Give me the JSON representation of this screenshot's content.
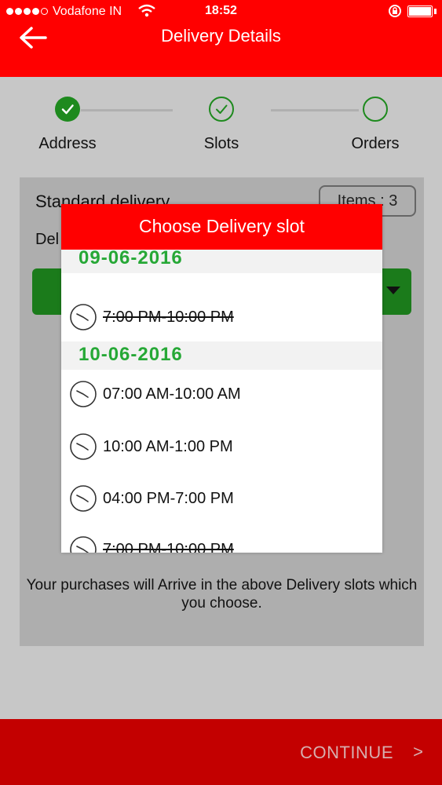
{
  "status_bar": {
    "carrier": "Vodafone IN",
    "time": "18:52"
  },
  "header": {
    "title": "Delivery Details"
  },
  "steps": [
    {
      "label": "Address",
      "state": "completed"
    },
    {
      "label": "Slots",
      "state": "current"
    },
    {
      "label": "Orders",
      "state": "pending"
    }
  ],
  "card": {
    "delivery_type": "Standard delivery",
    "items_badge": "Items : 3",
    "delivery_label": "Del",
    "note": "Your purchases will Arrive in the above Delivery slots which you choose."
  },
  "modal": {
    "title": "Choose Delivery slot",
    "groups": [
      {
        "date": "09-06-2016",
        "slots": [
          {
            "label": "7:00 PM-10:00 PM",
            "available": false
          }
        ]
      },
      {
        "date": "10-06-2016",
        "slots": [
          {
            "label": "07:00 AM-10:00 AM",
            "available": true
          },
          {
            "label": "10:00 AM-1:00 PM",
            "available": true
          },
          {
            "label": "04:00 PM-7:00 PM",
            "available": true
          },
          {
            "label": "7:00 PM-10:00 PM",
            "available": false
          }
        ]
      }
    ]
  },
  "footer": {
    "continue_label": "CONTINUE",
    "continue_chevron": ">"
  },
  "colors": {
    "brand_red": "#ff0000",
    "continue_red": "#c30000",
    "accent_green": "#26a836",
    "step_green": "#1e8a1e"
  },
  "icons": {
    "back": "arrow-left-icon",
    "slot": "clock-icon",
    "check": "checkmark-icon",
    "dropdown": "caret-down-icon"
  }
}
